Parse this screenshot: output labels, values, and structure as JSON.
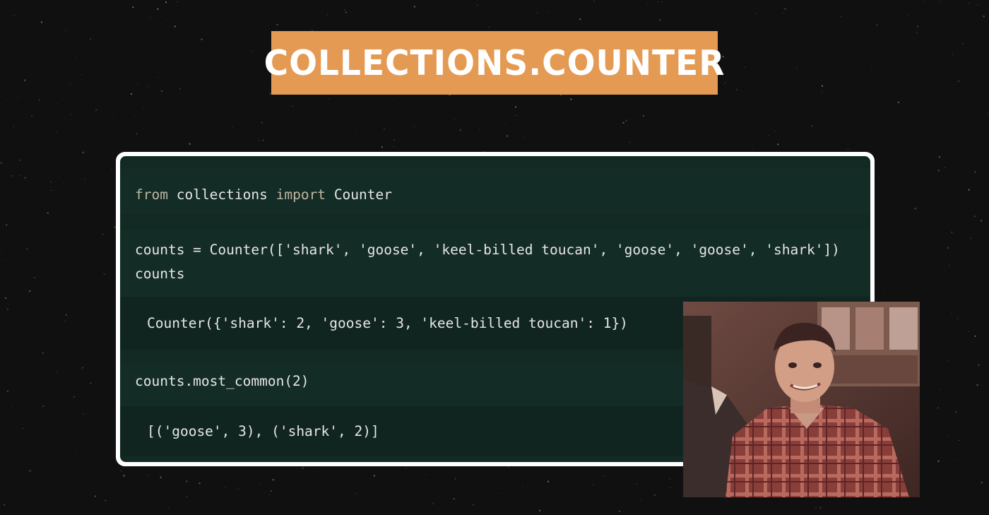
{
  "title": "COLLECTIONS.COUNTER",
  "code": {
    "line1": {
      "kw_from": "from",
      "module": "collections",
      "kw_import": "import",
      "name": "Counter"
    },
    "line2": "counts = Counter(['shark', 'goose', 'keel-billed toucan', 'goose', 'goose', 'shark'])",
    "line3": "counts",
    "output1": "Counter({'shark': 2, 'goose': 3, 'keel-billed toucan': 1})",
    "line4": "counts.most_common(2)",
    "output2": "[('goose', 3), ('shark', 2)]"
  },
  "colors": {
    "banner": "#e49a52",
    "code_background": "#132a24",
    "page_background": "#101010"
  }
}
